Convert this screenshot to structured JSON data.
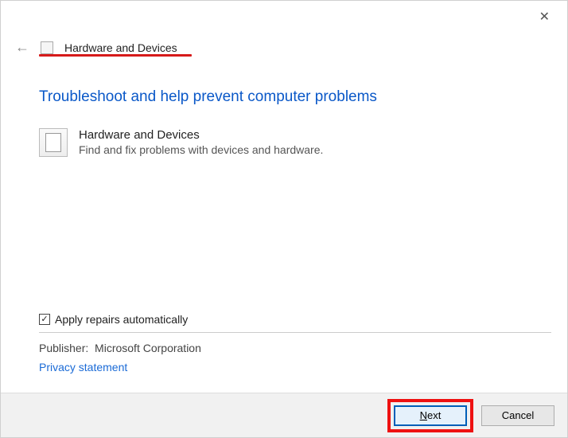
{
  "header": {
    "title": "Hardware and Devices"
  },
  "main": {
    "heading": "Troubleshoot and help prevent computer problems",
    "item": {
      "title": "Hardware and Devices",
      "description": "Find and fix problems with devices and hardware."
    }
  },
  "options": {
    "apply_repairs": {
      "label": "Apply repairs automatically",
      "checked": true
    }
  },
  "meta": {
    "publisher_label": "Publisher:",
    "publisher_value": "Microsoft Corporation",
    "privacy_link": "Privacy statement"
  },
  "footer": {
    "next_prefix": "N",
    "next_rest": "ext",
    "cancel": "Cancel"
  }
}
